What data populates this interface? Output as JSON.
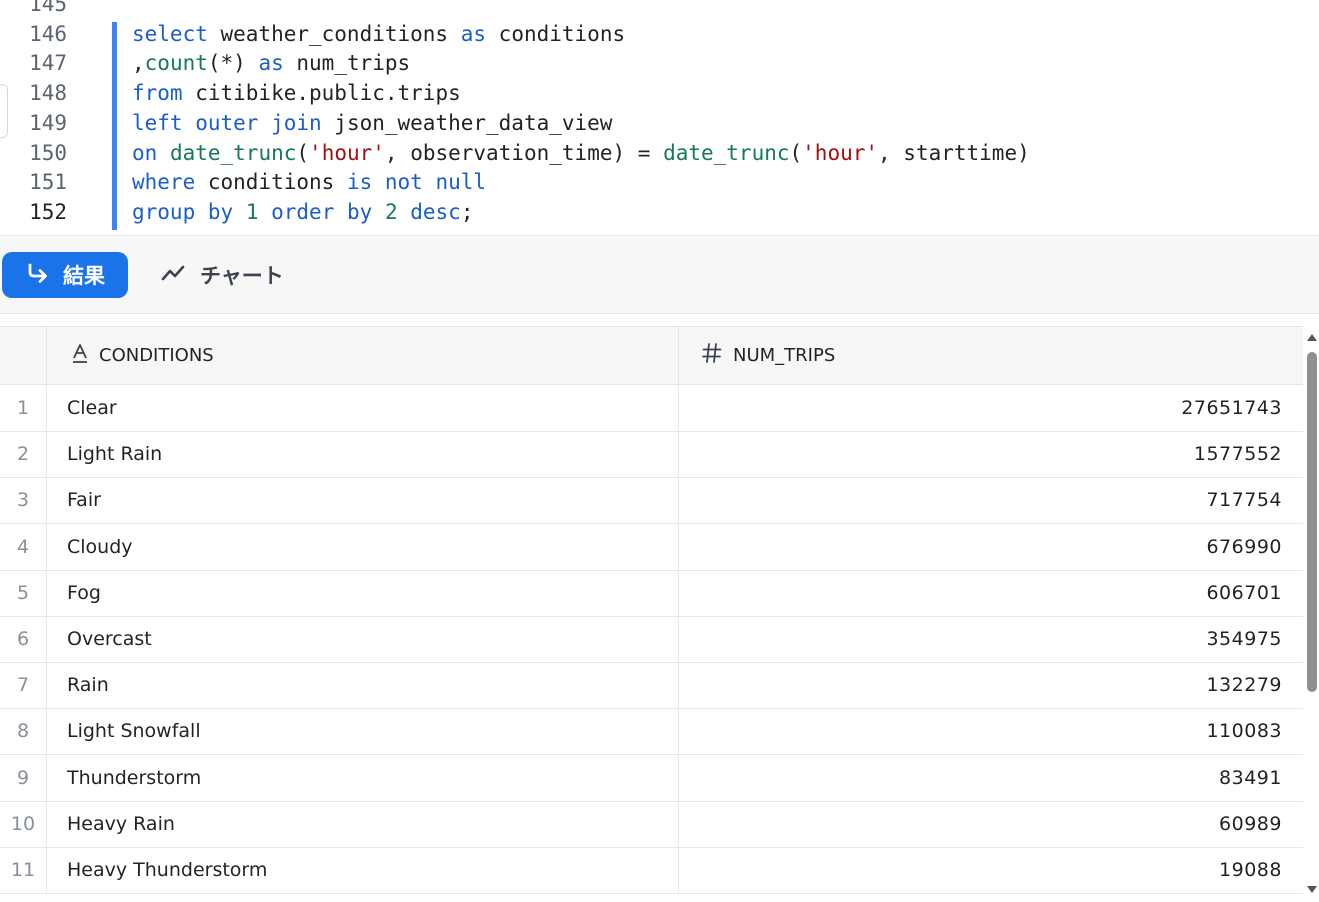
{
  "editor": {
    "lines": [
      {
        "num": "145",
        "tokens": []
      },
      {
        "num": "146",
        "tokens": [
          {
            "t": "select",
            "c": "kw"
          },
          {
            "t": " weather_conditions ",
            "c": ""
          },
          {
            "t": "as",
            "c": "kw"
          },
          {
            "t": " conditions",
            "c": ""
          }
        ]
      },
      {
        "num": "147",
        "tokens": [
          {
            "t": ",",
            "c": ""
          },
          {
            "t": "count",
            "c": "fn"
          },
          {
            "t": "(*) ",
            "c": ""
          },
          {
            "t": "as",
            "c": "kw"
          },
          {
            "t": " num_trips",
            "c": ""
          }
        ]
      },
      {
        "num": "148",
        "tokens": [
          {
            "t": "from",
            "c": "kw"
          },
          {
            "t": " citibike.public.trips",
            "c": ""
          }
        ]
      },
      {
        "num": "149",
        "tokens": [
          {
            "t": "left outer join",
            "c": "kw"
          },
          {
            "t": " json_weather_data_view",
            "c": ""
          }
        ]
      },
      {
        "num": "150",
        "tokens": [
          {
            "t": "on",
            "c": "kw"
          },
          {
            "t": " ",
            "c": ""
          },
          {
            "t": "date_trunc",
            "c": "fn"
          },
          {
            "t": "(",
            "c": ""
          },
          {
            "t": "'hour'",
            "c": "str"
          },
          {
            "t": ", observation_time) = ",
            "c": ""
          },
          {
            "t": "date_trunc",
            "c": "fn"
          },
          {
            "t": "(",
            "c": ""
          },
          {
            "t": "'hour'",
            "c": "str"
          },
          {
            "t": ", starttime)",
            "c": ""
          }
        ]
      },
      {
        "num": "151",
        "tokens": [
          {
            "t": "where",
            "c": "kw"
          },
          {
            "t": " conditions ",
            "c": ""
          },
          {
            "t": "is not null",
            "c": "kw"
          }
        ]
      },
      {
        "num": "152",
        "tokens": [
          {
            "t": "group by",
            "c": "kw"
          },
          {
            "t": " ",
            "c": ""
          },
          {
            "t": "1",
            "c": "fn"
          },
          {
            "t": " ",
            "c": ""
          },
          {
            "t": "order by",
            "c": "kw"
          },
          {
            "t": " ",
            "c": ""
          },
          {
            "t": "2",
            "c": "fn"
          },
          {
            "t": " ",
            "c": ""
          },
          {
            "t": "desc",
            "c": "kw"
          },
          {
            "t": ";",
            "c": ""
          }
        ]
      }
    ],
    "current_line": "152"
  },
  "tabs": {
    "results_label": "結果",
    "chart_label": "チャート",
    "results_icon": "return-arrow-icon",
    "chart_icon": "line-chart-icon",
    "accent": "#1a73e8"
  },
  "grid": {
    "columns": [
      {
        "label": "CONDITIONS",
        "icon": "text-type-icon"
      },
      {
        "label": "NUM_TRIPS",
        "icon": "number-type-icon"
      }
    ],
    "rows": [
      {
        "idx": "1",
        "conditions": "Clear",
        "num_trips": "27651743"
      },
      {
        "idx": "2",
        "conditions": "Light Rain",
        "num_trips": "1577552"
      },
      {
        "idx": "3",
        "conditions": "Fair",
        "num_trips": "717754"
      },
      {
        "idx": "4",
        "conditions": "Cloudy",
        "num_trips": "676990"
      },
      {
        "idx": "5",
        "conditions": "Fog",
        "num_trips": "606701"
      },
      {
        "idx": "6",
        "conditions": "Overcast",
        "num_trips": "354975"
      },
      {
        "idx": "7",
        "conditions": "Rain",
        "num_trips": "132279"
      },
      {
        "idx": "8",
        "conditions": "Light Snowfall",
        "num_trips": "110083"
      },
      {
        "idx": "9",
        "conditions": "Thunderstorm",
        "num_trips": "83491"
      },
      {
        "idx": "10",
        "conditions": "Heavy Rain",
        "num_trips": "60989"
      },
      {
        "idx": "11",
        "conditions": "Heavy Thunderstorm",
        "num_trips": "19088"
      }
    ]
  }
}
